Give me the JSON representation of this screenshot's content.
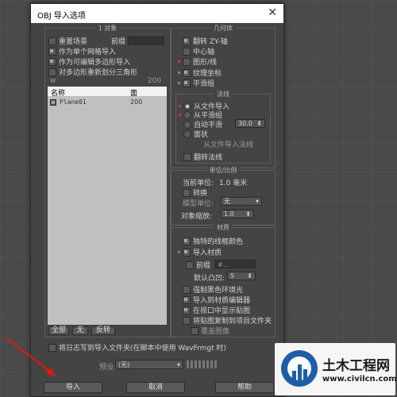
{
  "window": {
    "title": "OBJ 导入选项",
    "close_glyph": "✕"
  },
  "object_group": {
    "legend": "1 对象",
    "reset_scene": "重置场景",
    "prefix_label": "前缀",
    "single_mesh": "作为单个网格导入",
    "editable_poly": "作为可编辑多边形导入",
    "retriangulate": "对多边形重新划分三角形",
    "faces_count": "200",
    "table": {
      "col_name": "名称",
      "col_faces": "面",
      "rows": [
        {
          "name": "Plane01",
          "faces": "200"
        }
      ]
    },
    "btn_all": "全部",
    "btn_none": "无",
    "btn_invert": "反转"
  },
  "geometry_group": {
    "legend": "几何体",
    "flip_zy": "翻转 ZY-轴",
    "center_pivots": "中心轴",
    "shapes_lines": "图形/线",
    "texture_coords": "纹理坐标",
    "smooth_groups": "平滑组"
  },
  "normals_group": {
    "legend": "法线",
    "from_file": "从文件导入",
    "from_smooth": "从平滑组",
    "auto_smooth": "自动平滑",
    "auto_smooth_value": "30.0",
    "faceted": "面状",
    "import_normals_note": "从文件导入法线",
    "flip_normals": "翻转法线"
  },
  "units_group": {
    "legend": "单位/比例",
    "current_unit_label": "当前单位:",
    "current_unit_value": "1.0 毫米",
    "convert": "转换",
    "model_units_label": "模型单位:",
    "model_units_value": "无",
    "object_scale_label": "对象缩放:",
    "object_scale_value": "1.0"
  },
  "material_group": {
    "legend": "材质",
    "unique_wire_color": "独特的线框颜色",
    "import_materials": "导入材质",
    "prefix_label": "前缀",
    "prefix_value": "#...",
    "default_bump_label": "默认凸凹:",
    "default_bump_value": "5",
    "force_black_ambient": "强制黑色环境光",
    "import_into_editor": "导入到材质编辑器",
    "show_maps_viewport": "在视口中显示贴图",
    "copy_maps_to_project": "将贴图复制到项目文件夹",
    "overwrite_images": "覆盖图像"
  },
  "log": {
    "label": "将日志写到导入文件夹(在脚本中使用 WavFrmgt 时)"
  },
  "preset": {
    "label": "预设:",
    "value": "(无)"
  },
  "footer": {
    "import": "导入",
    "cancel": "取消",
    "help": "帮助"
  },
  "watermark": {
    "brand": "土木工程网",
    "url": "www.civilcn.com"
  },
  "colors": {
    "accent_red": "#c23a3a",
    "accent_green": "#4aa84a",
    "brand_blue": "#1e5ea8"
  }
}
